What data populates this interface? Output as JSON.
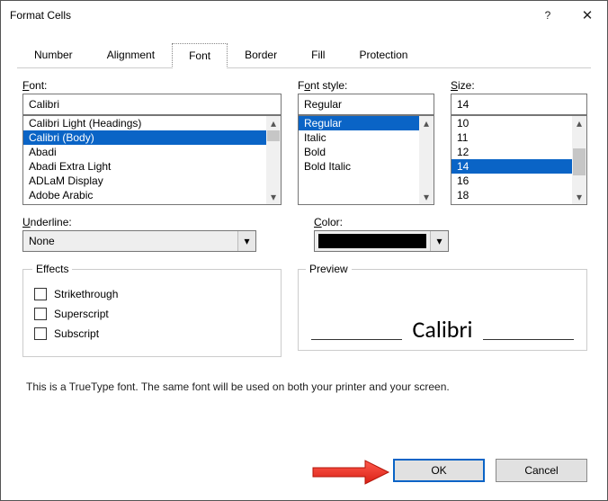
{
  "title": "Format Cells",
  "tabs": [
    "Number",
    "Alignment",
    "Font",
    "Border",
    "Fill",
    "Protection"
  ],
  "active_tab": "Font",
  "font": {
    "label": "Font:",
    "label_u": "F",
    "value": "Calibri",
    "items": [
      "Calibri Light (Headings)",
      "Calibri (Body)",
      "Abadi",
      "Abadi Extra Light",
      "ADLaM Display",
      "Adobe Arabic"
    ],
    "selected": "Calibri (Body)"
  },
  "font_style": {
    "label": "Font style:",
    "label_u": "o",
    "value": "Regular",
    "items": [
      "Regular",
      "Italic",
      "Bold",
      "Bold Italic"
    ],
    "selected": "Regular"
  },
  "size": {
    "label": "Size:",
    "label_u": "S",
    "value": "14",
    "items": [
      "10",
      "11",
      "12",
      "14",
      "16",
      "18"
    ],
    "selected": "14"
  },
  "underline": {
    "label": "Underline:",
    "label_u": "U",
    "value": "None"
  },
  "color": {
    "label": "Color:",
    "label_u": "C",
    "value_hex": "#000000"
  },
  "effects": {
    "legend": "Effects",
    "strikethrough": "Strikethrough",
    "strikethrough_u": "k",
    "superscript": "Superscript",
    "superscript_u": "p",
    "subscript": "Subscript",
    "subscript_u": "b"
  },
  "preview": {
    "legend": "Preview",
    "text": "Calibri"
  },
  "description": "This is a TrueType font.  The same font will be used on both your printer and your screen.",
  "buttons": {
    "ok": "OK",
    "cancel": "Cancel"
  }
}
